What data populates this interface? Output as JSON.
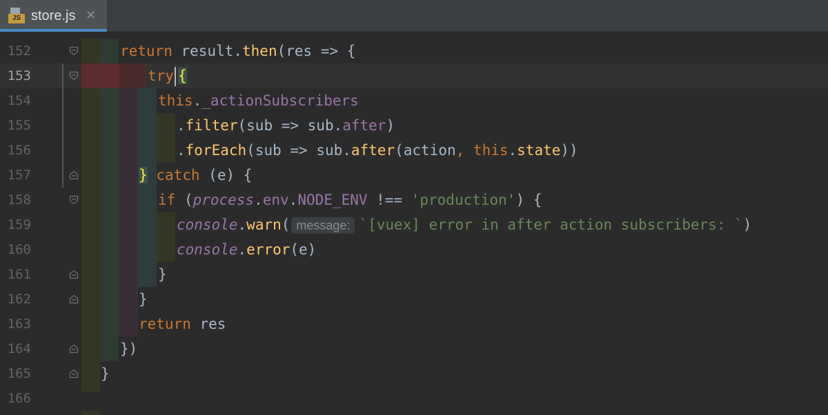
{
  "tab": {
    "icon_label": "JS",
    "file_name": "store.js",
    "close_glyph": "✕"
  },
  "colors": {
    "background": "#2b2b2b",
    "keyword": "#cc7832",
    "function": "#ffc66d",
    "property": "#9876aa",
    "string": "#6a8759",
    "tab_underline": "#4a88c7"
  },
  "editor": {
    "current_line": "153",
    "lines": [
      {
        "number": "152",
        "segments": [
          "return",
          " result.",
          "then",
          "(res => {"
        ]
      },
      {
        "number": "153",
        "segments": [
          "try",
          " ",
          "{"
        ]
      },
      {
        "number": "154",
        "segments": [
          "this",
          ".",
          "_actionSubscribers"
        ]
      },
      {
        "number": "155",
        "segments": [
          ".",
          "filter",
          "(sub => sub.",
          "after",
          ")"
        ]
      },
      {
        "number": "156",
        "segments": [
          ".",
          "forEach",
          "(sub => sub.",
          "after",
          "(action",
          ", ",
          "this",
          ".",
          "state",
          "))"
        ]
      },
      {
        "number": "157",
        "segments": [
          "}",
          " ",
          "catch",
          " (e) {"
        ]
      },
      {
        "number": "158",
        "segments": [
          "if",
          " (",
          "process",
          ".",
          "env",
          ".",
          "NODE_ENV",
          " !== ",
          "'production'",
          ") {"
        ]
      },
      {
        "number": "159",
        "segments": [
          "console",
          ".",
          "warn",
          "(",
          "message:",
          "`[vuex] error in after action subscribers: `",
          ")"
        ]
      },
      {
        "number": "160",
        "segments": [
          "console",
          ".",
          "error",
          "(e)"
        ]
      },
      {
        "number": "161",
        "segments": [
          "}"
        ]
      },
      {
        "number": "162",
        "segments": [
          "}"
        ]
      },
      {
        "number": "163",
        "segments": [
          "return",
          " res"
        ]
      },
      {
        "number": "164",
        "segments": [
          "})"
        ]
      },
      {
        "number": "165",
        "segments": [
          "}"
        ]
      },
      {
        "number": "166",
        "segments": []
      }
    ]
  }
}
